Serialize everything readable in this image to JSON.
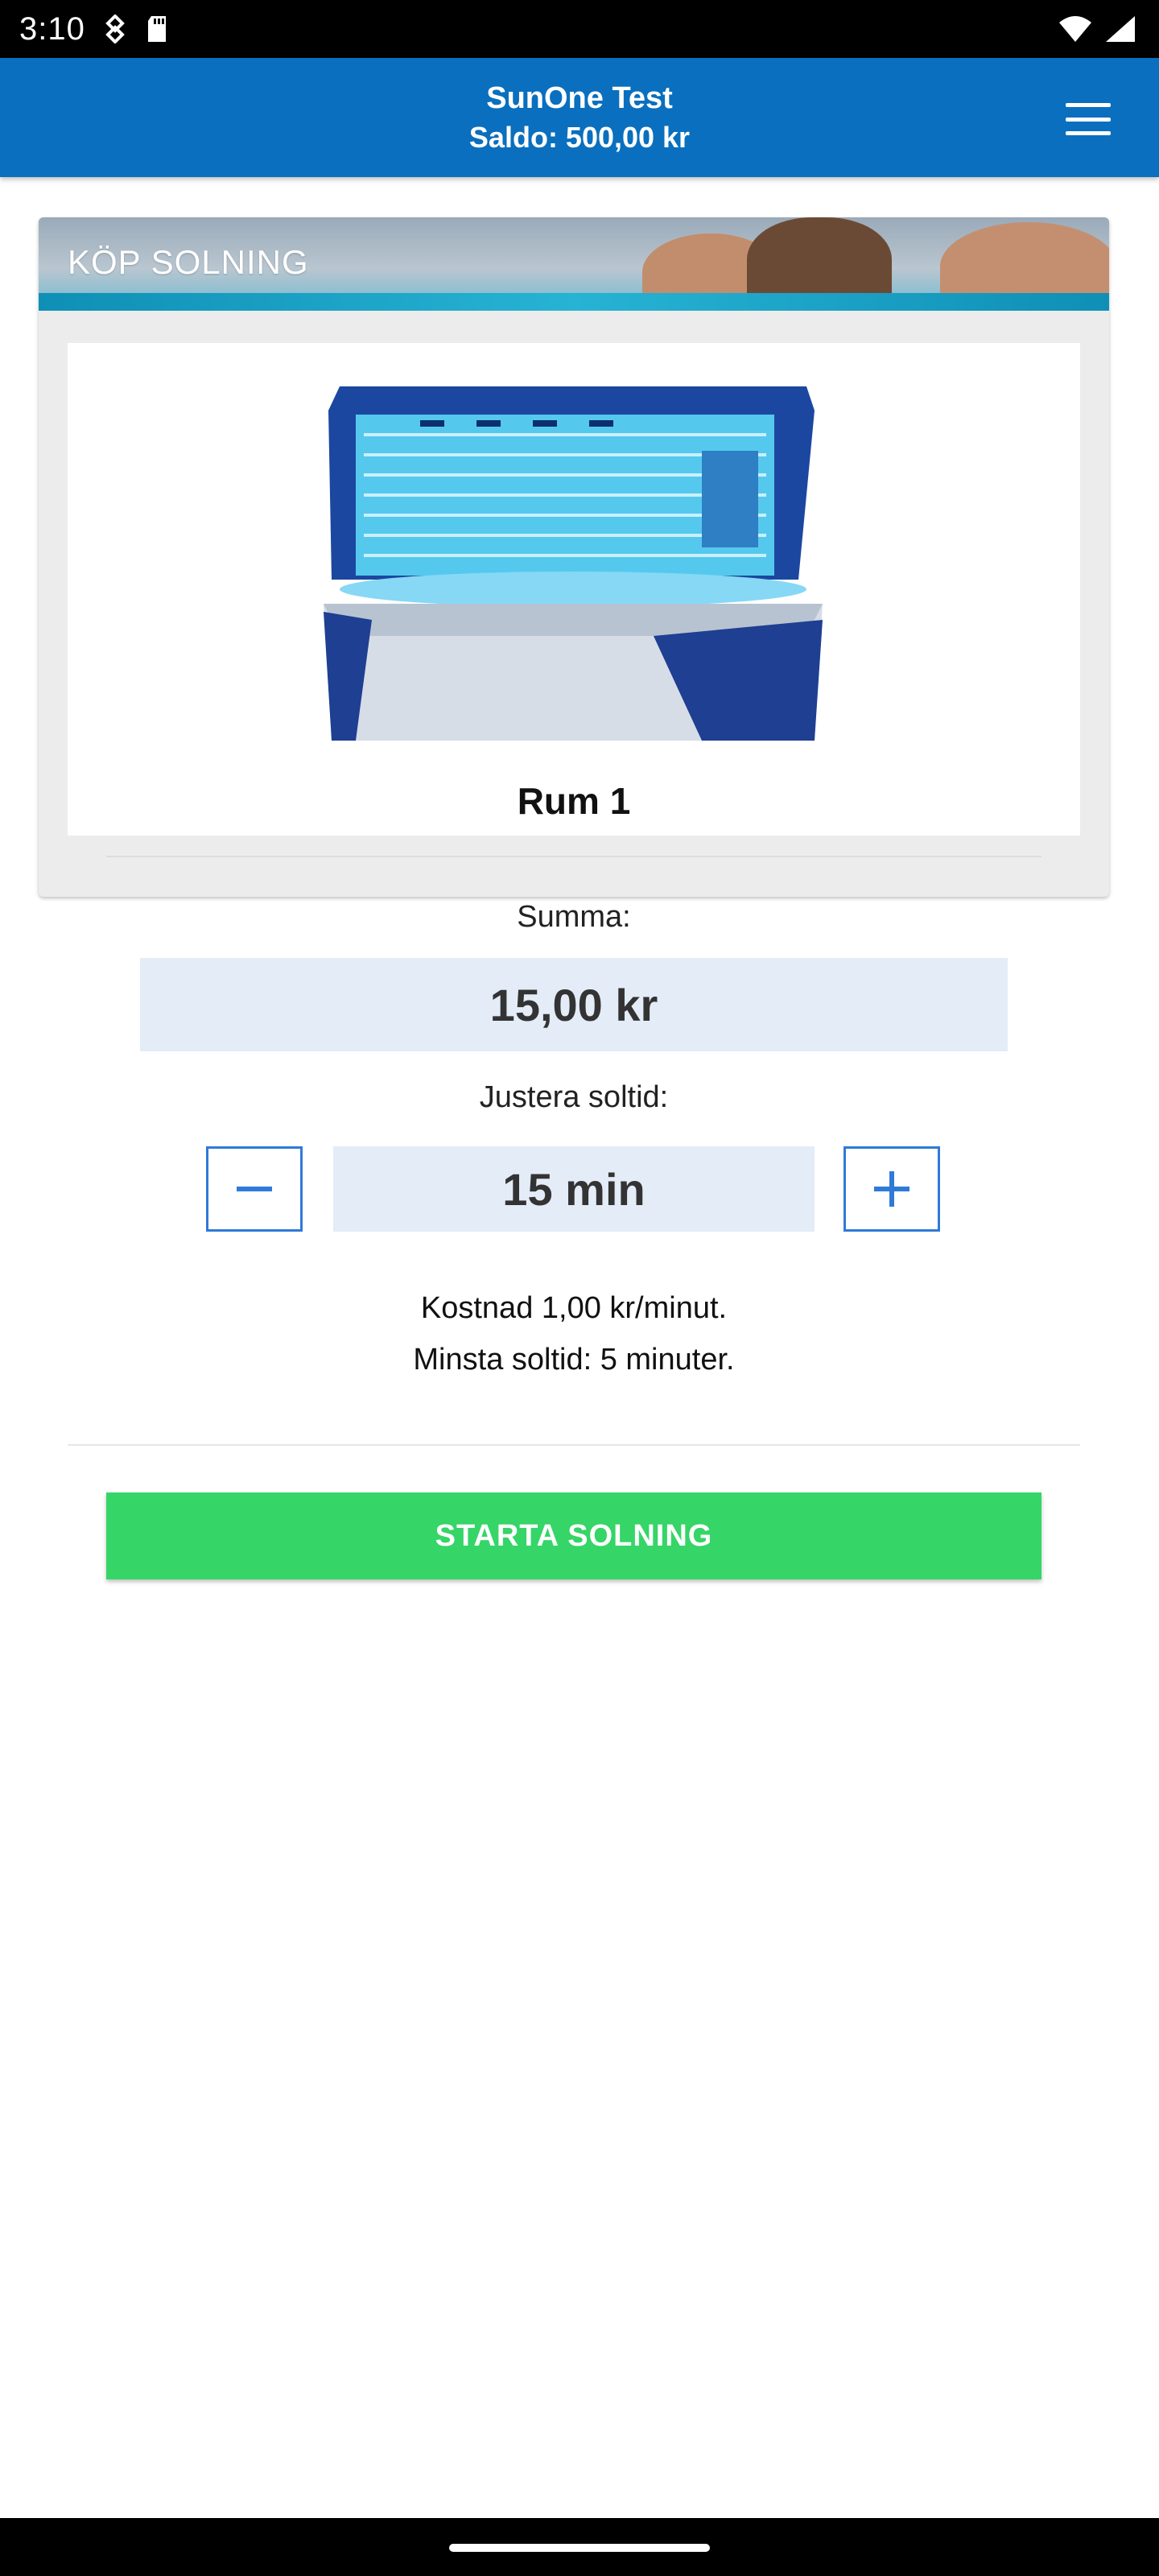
{
  "status_bar": {
    "time": "3:10",
    "icons": [
      "usb-debug-icon",
      "sd-card-icon",
      "wifi-icon",
      "signal-icon"
    ]
  },
  "header": {
    "title": "SunOne Test",
    "balance": "Saldo: 500,00 kr",
    "menu_icon": "hamburger-menu-icon",
    "color": "#0a6fbe"
  },
  "card": {
    "title": "KÖP SOLNING",
    "room_name": "Rum 1",
    "summa_label": "Summa:",
    "summa_value": "15,00 kr",
    "adjust_label": "Justera soltid:",
    "minus_symbol": "−",
    "plus_symbol": "+",
    "time_value": "15 min",
    "cost_info": "Kostnad 1,00 kr/minut.",
    "min_info": "Minsta soltid: 5 minuter.",
    "start_button": "STARTA SOLNING",
    "start_color": "#35d567",
    "stepper_color": "#2f7ad8"
  }
}
